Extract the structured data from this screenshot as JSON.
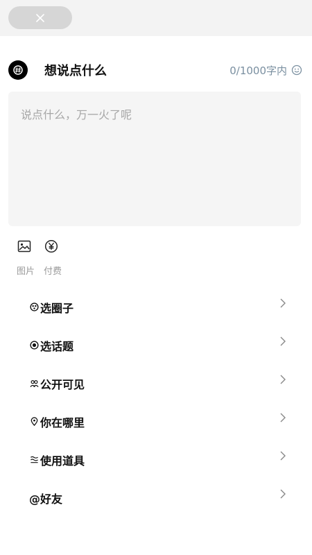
{
  "top_bar": {
    "close_icon": "close-icon"
  },
  "header": {
    "badge_icon": "topic-badge-icon",
    "title": "想说点什么",
    "char_counter": "0/1000字内",
    "emoji_icon": "emoji-icon"
  },
  "editor": {
    "placeholder": "说点什么，万一火了呢"
  },
  "tools": [
    {
      "icon": "image-icon",
      "label": "图片"
    },
    {
      "icon": "yen-icon",
      "label": "付费"
    }
  ],
  "menu": [
    {
      "icon": "circle-group-icon",
      "label": "选圈子"
    },
    {
      "icon": "topic-icon",
      "label": "选话题"
    },
    {
      "icon": "people-icon",
      "label": "公开可见"
    },
    {
      "icon": "location-icon",
      "label": "你在哪里"
    },
    {
      "icon": "props-icon",
      "label": "使用道具"
    },
    {
      "icon": "",
      "label": "@好友"
    }
  ],
  "colors": {
    "counter_text": "#7a8fa0",
    "placeholder_text": "#a6a6a6",
    "editor_bg": "#f5f5f5",
    "close_pill_bg": "#d6d6d6"
  }
}
